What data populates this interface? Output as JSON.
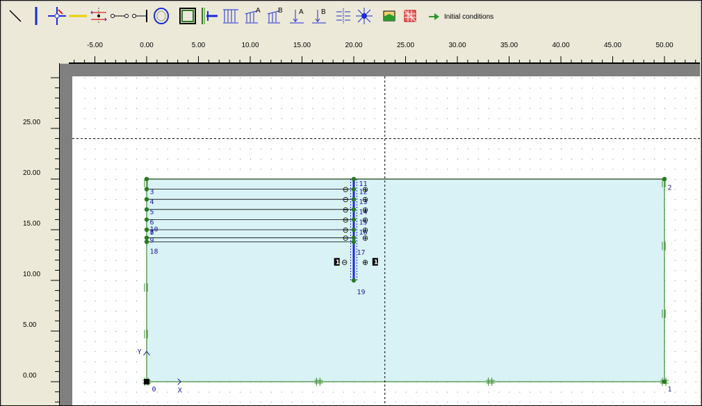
{
  "toolbar": {
    "tools": [
      {
        "name": "line-tool-icon"
      },
      {
        "name": "plate-tool-icon"
      },
      {
        "name": "hinge-tool-icon"
      },
      {
        "name": "geogrid-tool-icon"
      },
      {
        "name": "node-to-node-anchor-icon"
      },
      {
        "name": "fixed-end-anchor-icon"
      },
      {
        "name": "tunnel-icon"
      },
      {
        "name": "standard-fixities-icon"
      },
      {
        "name": "horizontal-fixity-icon"
      },
      {
        "name": "distributed-load-icon"
      },
      {
        "name": "distributed-load-a-icon"
      },
      {
        "name": "distributed-load-b-icon"
      },
      {
        "name": "point-load-a-icon"
      },
      {
        "name": "point-load-b-icon"
      },
      {
        "name": "prescribed-displacement-icon"
      },
      {
        "name": "rotation-fixity-icon"
      },
      {
        "name": "material-sets-icon"
      },
      {
        "name": "generate-mesh-icon"
      }
    ],
    "initial_conditions_label": "Initial conditions"
  },
  "ruler": {
    "x_labels": [
      "-5.00",
      "0.00",
      "5.00",
      "10.00",
      "15.00",
      "20.00",
      "25.00",
      "30.00",
      "35.00",
      "40.00",
      "45.00",
      "50.00"
    ],
    "y_labels": [
      "25.00",
      "20.00",
      "15.00",
      "10.00",
      "5.00",
      "0.00"
    ]
  },
  "model": {
    "point_labels": [
      "0",
      "1",
      "2",
      "3",
      "4",
      "5",
      "6",
      "7",
      "8",
      "9",
      "10",
      "11",
      "12",
      "13",
      "14",
      "15",
      "16",
      "17",
      "18",
      "19"
    ],
    "axis_x_label": "X",
    "axis_y_label": "Y",
    "interface_minus": "⊖",
    "interface_plus": "⊕",
    "interface_number": "1",
    "colors": {
      "soil_fill": "#d9f2f5",
      "boundary": "#3a8a2e",
      "plate": "#1a2ad6",
      "node": "#2a7a1e",
      "label": "#1a1aa0",
      "grid_dot": "#7a7a7a"
    }
  }
}
